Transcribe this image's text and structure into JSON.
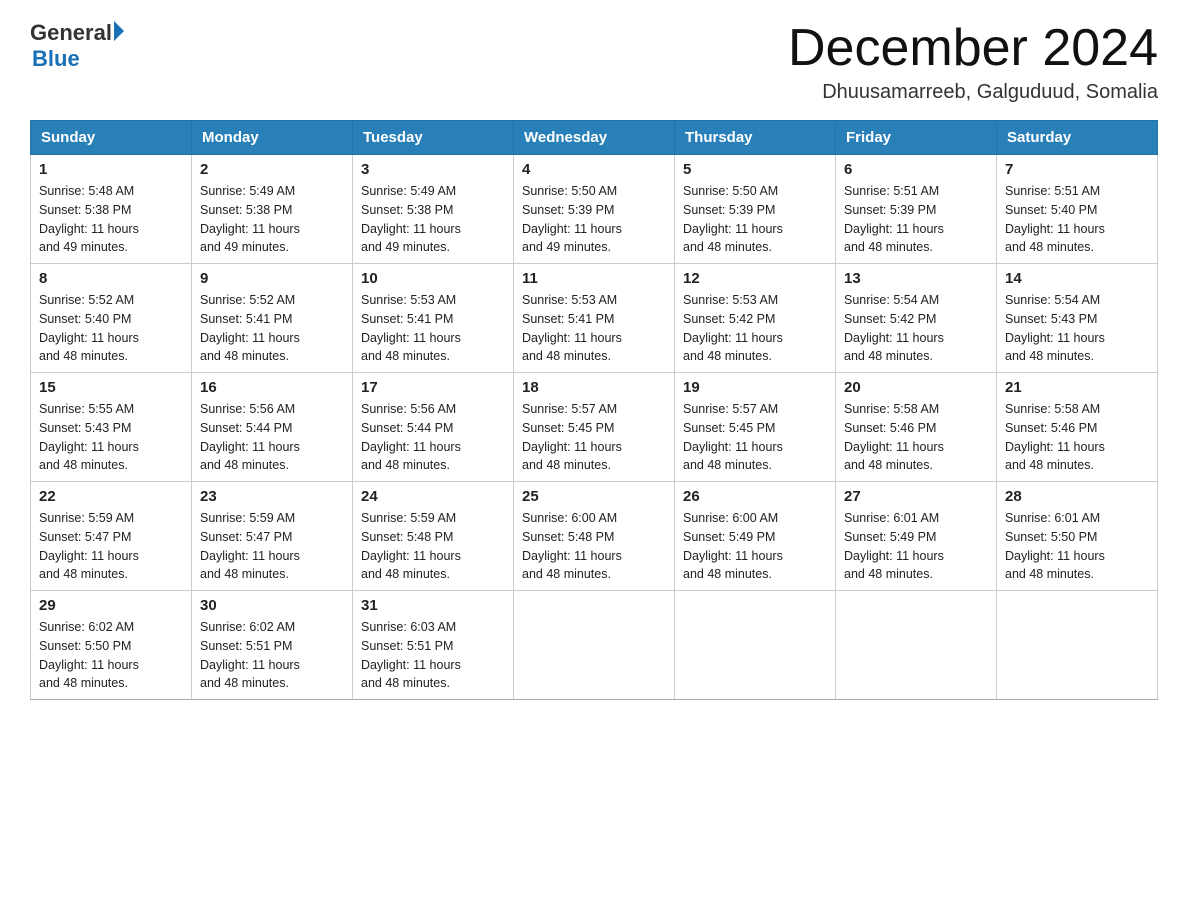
{
  "header": {
    "logo_general": "General",
    "logo_blue": "Blue",
    "month_title": "December 2024",
    "location": "Dhuusamarreeb, Galguduud, Somalia"
  },
  "days_of_week": [
    "Sunday",
    "Monday",
    "Tuesday",
    "Wednesday",
    "Thursday",
    "Friday",
    "Saturday"
  ],
  "weeks": [
    [
      {
        "day": "1",
        "sunrise": "5:48 AM",
        "sunset": "5:38 PM",
        "daylight": "11 hours and 49 minutes."
      },
      {
        "day": "2",
        "sunrise": "5:49 AM",
        "sunset": "5:38 PM",
        "daylight": "11 hours and 49 minutes."
      },
      {
        "day": "3",
        "sunrise": "5:49 AM",
        "sunset": "5:38 PM",
        "daylight": "11 hours and 49 minutes."
      },
      {
        "day": "4",
        "sunrise": "5:50 AM",
        "sunset": "5:39 PM",
        "daylight": "11 hours and 49 minutes."
      },
      {
        "day": "5",
        "sunrise": "5:50 AM",
        "sunset": "5:39 PM",
        "daylight": "11 hours and 48 minutes."
      },
      {
        "day": "6",
        "sunrise": "5:51 AM",
        "sunset": "5:39 PM",
        "daylight": "11 hours and 48 minutes."
      },
      {
        "day": "7",
        "sunrise": "5:51 AM",
        "sunset": "5:40 PM",
        "daylight": "11 hours and 48 minutes."
      }
    ],
    [
      {
        "day": "8",
        "sunrise": "5:52 AM",
        "sunset": "5:40 PM",
        "daylight": "11 hours and 48 minutes."
      },
      {
        "day": "9",
        "sunrise": "5:52 AM",
        "sunset": "5:41 PM",
        "daylight": "11 hours and 48 minutes."
      },
      {
        "day": "10",
        "sunrise": "5:53 AM",
        "sunset": "5:41 PM",
        "daylight": "11 hours and 48 minutes."
      },
      {
        "day": "11",
        "sunrise": "5:53 AM",
        "sunset": "5:41 PM",
        "daylight": "11 hours and 48 minutes."
      },
      {
        "day": "12",
        "sunrise": "5:53 AM",
        "sunset": "5:42 PM",
        "daylight": "11 hours and 48 minutes."
      },
      {
        "day": "13",
        "sunrise": "5:54 AM",
        "sunset": "5:42 PM",
        "daylight": "11 hours and 48 minutes."
      },
      {
        "day": "14",
        "sunrise": "5:54 AM",
        "sunset": "5:43 PM",
        "daylight": "11 hours and 48 minutes."
      }
    ],
    [
      {
        "day": "15",
        "sunrise": "5:55 AM",
        "sunset": "5:43 PM",
        "daylight": "11 hours and 48 minutes."
      },
      {
        "day": "16",
        "sunrise": "5:56 AM",
        "sunset": "5:44 PM",
        "daylight": "11 hours and 48 minutes."
      },
      {
        "day": "17",
        "sunrise": "5:56 AM",
        "sunset": "5:44 PM",
        "daylight": "11 hours and 48 minutes."
      },
      {
        "day": "18",
        "sunrise": "5:57 AM",
        "sunset": "5:45 PM",
        "daylight": "11 hours and 48 minutes."
      },
      {
        "day": "19",
        "sunrise": "5:57 AM",
        "sunset": "5:45 PM",
        "daylight": "11 hours and 48 minutes."
      },
      {
        "day": "20",
        "sunrise": "5:58 AM",
        "sunset": "5:46 PM",
        "daylight": "11 hours and 48 minutes."
      },
      {
        "day": "21",
        "sunrise": "5:58 AM",
        "sunset": "5:46 PM",
        "daylight": "11 hours and 48 minutes."
      }
    ],
    [
      {
        "day": "22",
        "sunrise": "5:59 AM",
        "sunset": "5:47 PM",
        "daylight": "11 hours and 48 minutes."
      },
      {
        "day": "23",
        "sunrise": "5:59 AM",
        "sunset": "5:47 PM",
        "daylight": "11 hours and 48 minutes."
      },
      {
        "day": "24",
        "sunrise": "5:59 AM",
        "sunset": "5:48 PM",
        "daylight": "11 hours and 48 minutes."
      },
      {
        "day": "25",
        "sunrise": "6:00 AM",
        "sunset": "5:48 PM",
        "daylight": "11 hours and 48 minutes."
      },
      {
        "day": "26",
        "sunrise": "6:00 AM",
        "sunset": "5:49 PM",
        "daylight": "11 hours and 48 minutes."
      },
      {
        "day": "27",
        "sunrise": "6:01 AM",
        "sunset": "5:49 PM",
        "daylight": "11 hours and 48 minutes."
      },
      {
        "day": "28",
        "sunrise": "6:01 AM",
        "sunset": "5:50 PM",
        "daylight": "11 hours and 48 minutes."
      }
    ],
    [
      {
        "day": "29",
        "sunrise": "6:02 AM",
        "sunset": "5:50 PM",
        "daylight": "11 hours and 48 minutes."
      },
      {
        "day": "30",
        "sunrise": "6:02 AM",
        "sunset": "5:51 PM",
        "daylight": "11 hours and 48 minutes."
      },
      {
        "day": "31",
        "sunrise": "6:03 AM",
        "sunset": "5:51 PM",
        "daylight": "11 hours and 48 minutes."
      },
      null,
      null,
      null,
      null
    ]
  ],
  "labels": {
    "sunrise": "Sunrise:",
    "sunset": "Sunset:",
    "daylight": "Daylight:"
  }
}
